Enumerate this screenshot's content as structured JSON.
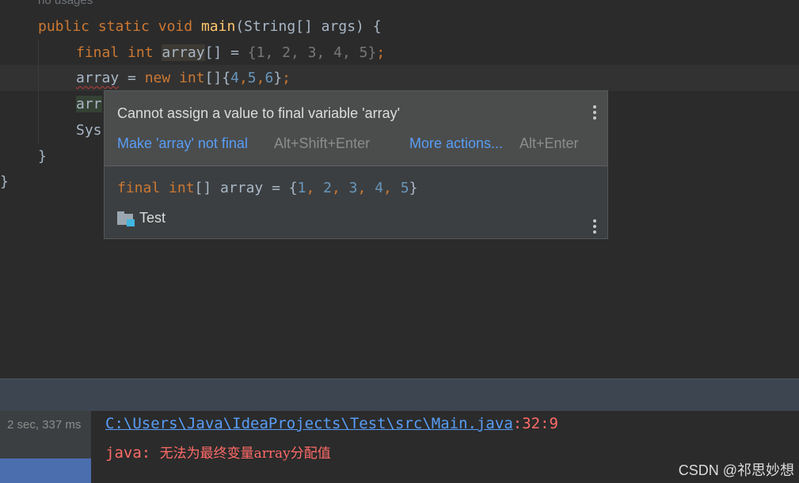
{
  "editor": {
    "usage_hint": "no usages",
    "line1": {
      "kw1": "public",
      "kw2": "static",
      "kw3": "void",
      "fn": "main",
      "rest": "(String[] args) {"
    },
    "line2": {
      "kw1": "final",
      "kw2": "int",
      "var": "array",
      "rest": "[] = ",
      "values": "{1, 2, 3, 4, 5}",
      "semi": ";"
    },
    "line3": {
      "var": "array",
      "eq": " = ",
      "kw": "new",
      "type": "int",
      "init_open": "[]{",
      "n1": "4",
      "c1": ",",
      "n2": "5",
      "c2": ",",
      "n3": "6",
      "init_close": "}",
      "semi": ";"
    },
    "line4": {
      "partial": "arr"
    },
    "line5": {
      "partial": "Sys"
    },
    "line6": {
      "brace": "}"
    },
    "line7": {
      "brace": "}"
    }
  },
  "popup": {
    "message": "Cannot assign a value to final variable 'array'",
    "fix_action": "Make 'array' not final",
    "fix_shortcut": "Alt+Shift+Enter",
    "more_action": "More actions...",
    "more_shortcut": "Alt+Enter",
    "decl": {
      "kw1": "final",
      "kw2": "int",
      "rest": "[] array = {",
      "n1": "1",
      "n2": "2",
      "n3": "3",
      "n4": "4",
      "n5": "5",
      "sep": ", ",
      "close": "}"
    },
    "class_name": "Test"
  },
  "console": {
    "duration": "2 sec, 337 ms",
    "path": "C:\\Users\\Java\\IdeaProjects\\Test\\src\\Main.java",
    "position": ":32:9",
    "error_prefix": "java: ",
    "error_text": "无法为最终变量array分配值"
  },
  "watermark": "CSDN @祁思妙想",
  "colors": {
    "keyword": "#cc7832",
    "function": "#ffc66d",
    "number": "#6897bb",
    "link": "#589df6",
    "error": "#ff6b68"
  },
  "icons": {
    "more": "more-vertical-icon",
    "folder": "folder-icon"
  }
}
